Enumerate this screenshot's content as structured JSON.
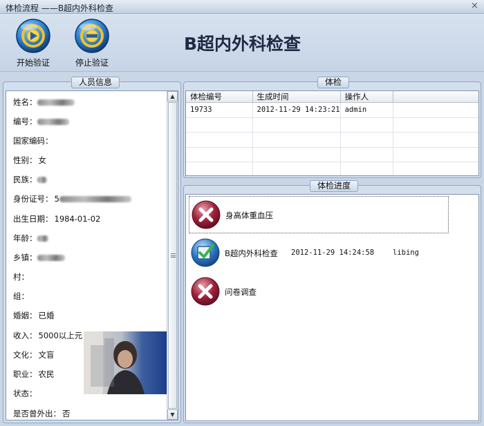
{
  "window": {
    "title": "体检流程 ——B超内外科检查",
    "close": "×"
  },
  "toolbar": {
    "start_label": "开始验证",
    "stop_label": "停止验证",
    "page_title": "B超内外科检查"
  },
  "person_panel": {
    "title": "人员信息",
    "fields": [
      {
        "label": "姓名：",
        "value": ""
      },
      {
        "label": "编号：",
        "value": ""
      },
      {
        "label": "国家编码：",
        "value": ""
      },
      {
        "label": "性别：",
        "value": "女"
      },
      {
        "label": "民族：",
        "value": ""
      },
      {
        "label": "身份证号：",
        "value": "5"
      },
      {
        "label": "出生日期：",
        "value": "1984-01-02"
      },
      {
        "label": "年龄：",
        "value": ""
      },
      {
        "label": "乡镇：",
        "value": ""
      },
      {
        "label": "村：",
        "value": ""
      },
      {
        "label": "组：",
        "value": ""
      },
      {
        "label": "婚姻：",
        "value": "已婚"
      },
      {
        "label": "收入：",
        "value": "5000以上元"
      },
      {
        "label": "文化：",
        "value": "文盲"
      },
      {
        "label": "职业：",
        "value": "农民"
      },
      {
        "label": "状态：",
        "value": ""
      },
      {
        "label": "是否曾外出：",
        "value": "否"
      }
    ],
    "scroll_up": "▲",
    "scroll_down": "▼"
  },
  "exam_panel": {
    "title": "体检",
    "columns": [
      "体检编号",
      "生成时间",
      "操作人",
      ""
    ],
    "rows": [
      [
        "19733",
        "2012-11-29 14:23:21",
        "admin",
        ""
      ],
      [
        "",
        "",
        "",
        ""
      ],
      [
        "",
        "",
        "",
        ""
      ],
      [
        "",
        "",
        "",
        ""
      ],
      [
        "",
        "",
        "",
        ""
      ]
    ]
  },
  "progress_panel": {
    "title": "体检进度",
    "items": [
      {
        "name": "身高体重血压",
        "status": "failed",
        "icon": "x-circle-icon",
        "time": "",
        "user": ""
      },
      {
        "name": "B超内外科检查",
        "status": "done",
        "icon": "check-box-icon",
        "time": "2012-11-29 14:24:58",
        "user": "libing"
      },
      {
        "name": "问卷调查",
        "status": "failed",
        "icon": "x-circle-icon",
        "time": "",
        "user": ""
      }
    ]
  },
  "colors": {
    "accent": "#1f2a44",
    "panel_border": "#8fa6c4",
    "fail": "#a0203a",
    "ok": "#2f78c4"
  }
}
